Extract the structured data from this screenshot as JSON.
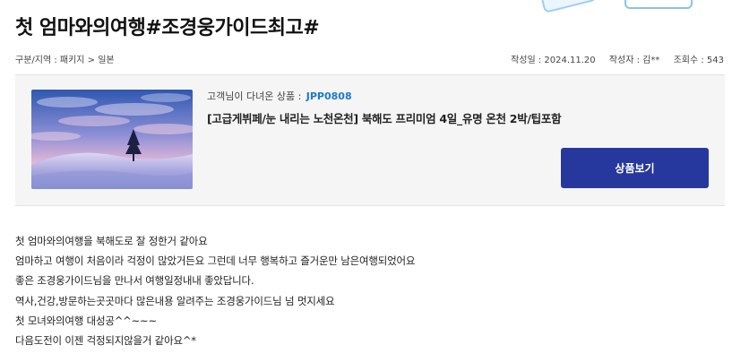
{
  "post": {
    "title": "첫 엄마와의여행#조경웅가이드최고#",
    "breadcrumb": "구분/지역 : 패키지 > 일본",
    "date": "작성일 : 2024.11.20",
    "author": "작성자 : 김**",
    "views": "조회수 : 543"
  },
  "product": {
    "label": "고객님이 다녀온 상품 :",
    "code": "JPP0808",
    "name": "[고급게뷔페/눈 내리는 노천온천] 북해도 프리미엄 4일_유명 온천 2박/팁포함",
    "button_label": "상품보기",
    "image": "snowy hill with single tree at dusk"
  },
  "review": {
    "lines": [
      "첫 엄마와의여행을 북해도로 잘 정한거 같아요",
      "엄마하고 여행이 처음이라 걱정이 많았거든요 그런데 너무 행복하고 즐거운만 남은여행되었어요",
      "좋은 조경웅가이드님을 만나서 여행일정내내 좋았답니다.",
      "역사,건강,방문하는곳곳마다 많은내용 알려주는 조경웅가이드님 넘 멋지세요",
      "첫 모녀와의여행 대성공^^~~~",
      "다음도전이 이젠 걱정되지않을거 같아요^*"
    ]
  },
  "colors": {
    "accent": "#26389d",
    "code": "#1d79c8",
    "panel": "#f5f5f5"
  }
}
